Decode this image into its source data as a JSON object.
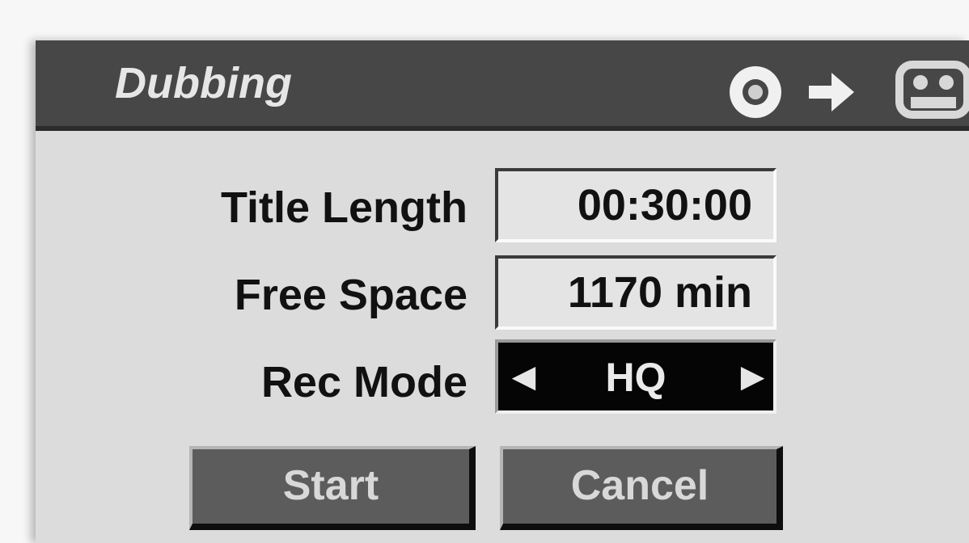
{
  "dialog": {
    "title": "Dubbing",
    "title_icons": [
      "disc-icon",
      "arrow-right-icon",
      "cassette-icon"
    ]
  },
  "fields": {
    "title_length": {
      "label": "Title Length",
      "value": "00:30:00"
    },
    "free_space": {
      "label": "Free Space",
      "value": "1170 min"
    },
    "rec_mode": {
      "label": "Rec Mode",
      "value": "HQ"
    }
  },
  "buttons": {
    "start": "Start",
    "cancel": "Cancel"
  },
  "colors": {
    "titlebar": "#474747",
    "panel": "#dcdcdc",
    "button": "#5c5c5c",
    "selector": "#050505"
  }
}
